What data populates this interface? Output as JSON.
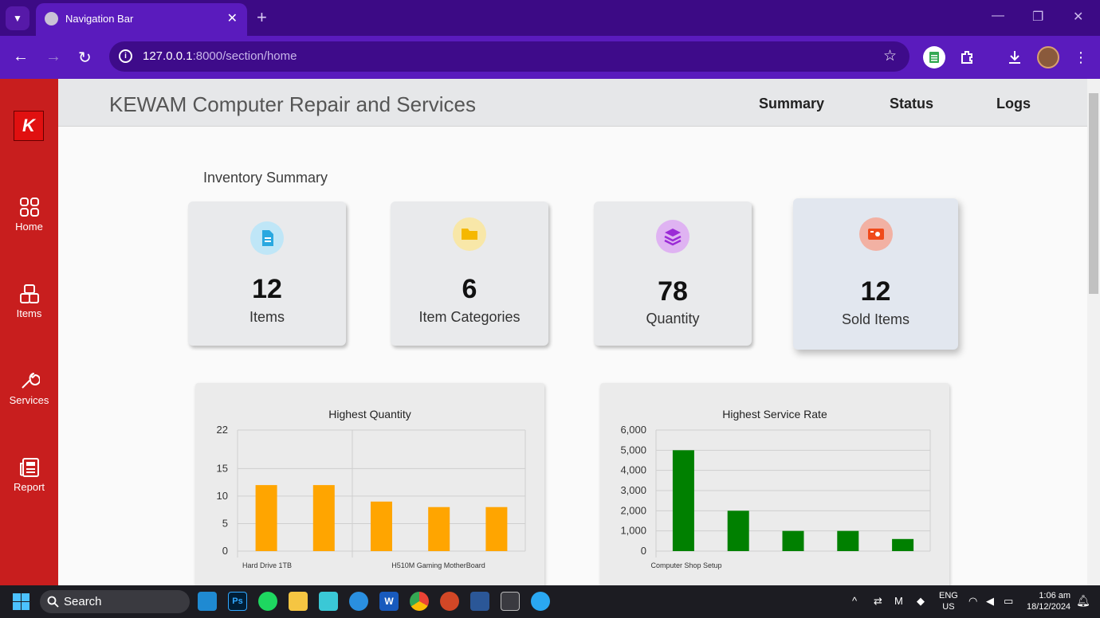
{
  "browser": {
    "tab_title": "Navigation Bar",
    "url_host": "127.0.0.1",
    "url_rest": ":8000/section/home"
  },
  "sidebar": {
    "items": [
      {
        "label": "Home",
        "icon": "grid-icon"
      },
      {
        "label": "Items",
        "icon": "boxes-icon"
      },
      {
        "label": "Services",
        "icon": "wrench-icon"
      },
      {
        "label": "Report",
        "icon": "newspaper-icon"
      }
    ]
  },
  "header": {
    "brand": "KEWAM Computer Repair and Services",
    "links": [
      "Summary",
      "Status",
      "Logs"
    ]
  },
  "summary": {
    "title": "Inventory Summary",
    "cards": [
      {
        "value": "12",
        "label": "Items",
        "icon": "document-icon",
        "color": "#29a8e0"
      },
      {
        "value": "6",
        "label": "Item Categories",
        "icon": "folder-icon",
        "color": "#f5b800"
      },
      {
        "value": "78",
        "label": "Quantity",
        "icon": "layers-icon",
        "color": "#9b2bd6"
      },
      {
        "value": "12",
        "label": "Sold Items",
        "icon": "wallet-icon",
        "color": "#f04a1a"
      }
    ]
  },
  "chart_data": [
    {
      "type": "bar",
      "title": "Highest Quantity",
      "categories": [
        "Hard Drive 1TB",
        "",
        "H510M Gaming MotherBoard",
        "",
        ""
      ],
      "values": [
        12,
        12,
        9,
        8,
        8
      ],
      "yticks": [
        0,
        5,
        10,
        15,
        22
      ],
      "ylim": [
        0,
        22
      ],
      "color": "#ffa500"
    },
    {
      "type": "bar",
      "title": "Highest Service Rate",
      "categories": [
        "Computer Shop Setup",
        "",
        "",
        "",
        ""
      ],
      "values": [
        5000,
        2000,
        1000,
        1000,
        600
      ],
      "yticks": [
        "0",
        "1,000",
        "2,000",
        "3,000",
        "4,000",
        "5,000",
        "6,000"
      ],
      "ylim": [
        0,
        6000
      ],
      "color": "#008000"
    }
  ],
  "taskbar": {
    "search": "Search",
    "lang": "ENG",
    "region": "US",
    "time": "1:06 am",
    "date": "18/12/2024"
  }
}
